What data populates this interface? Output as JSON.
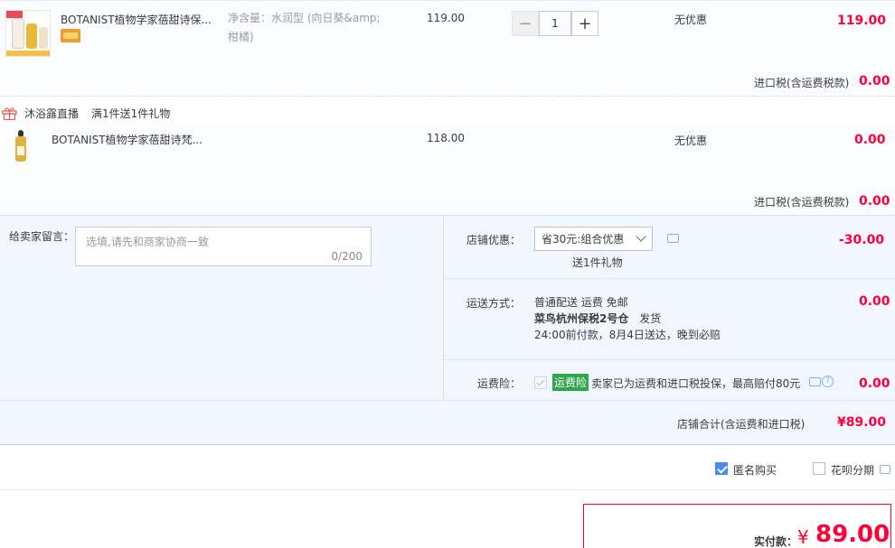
{
  "items": [
    {
      "title": "BOTANIST植物学家蓓甜诗保...",
      "spec": "净含量：水润型 (向日葵&amp;柑橘)",
      "price": "119.00",
      "qty": "1",
      "discount": "无优惠",
      "subtotal": "119.00",
      "tax_label": "进口税(含运费税款)",
      "tax_value": "0.00"
    },
    {
      "title": "BOTANIST植物学家蓓甜诗梵...",
      "price": "118.00",
      "discount": "无优惠",
      "subtotal": "0.00",
      "tax_label": "进口税(含运费税款)",
      "tax_value": "0.00"
    }
  ],
  "promo": {
    "name": "沐浴露直播",
    "desc": "满1件送1件礼物"
  },
  "memo": {
    "label": "给卖家留言：",
    "placeholder": "选填,请先和商家协商一致",
    "count": "0/200"
  },
  "shop_discount": {
    "label": "店铺优惠：",
    "selected": "省30元:组合优惠",
    "gift": "送1件礼物",
    "amount": "-30.00"
  },
  "shipping": {
    "label": "运送方式：",
    "line1": "普通配送 运费 免邮",
    "line2_bold": "菜鸟杭州保税2号仓",
    "line2_rest": "发货",
    "line3": "24:00前付款，8月4日送达，晚到必赔",
    "amount": "0.00"
  },
  "insurance": {
    "label": "运费险：",
    "badge": "运费险",
    "text": "卖家已为运费和进口税投保，最高赔付80元",
    "amount": "0.00"
  },
  "shop_total": {
    "label": "店铺合计(含运费和进口税)",
    "value": "¥89.00"
  },
  "options": {
    "anonymous": "匿名购买",
    "huabei": "花呗分期"
  },
  "pay": {
    "label": "实付款：",
    "currency": "¥",
    "value": "89.00"
  },
  "colors": {
    "accent_red": "#ff0036",
    "panel_bg": "#f2f7ff",
    "insurance_green": "#2ea64b",
    "checkbox_blue": "#4a8bf0"
  }
}
